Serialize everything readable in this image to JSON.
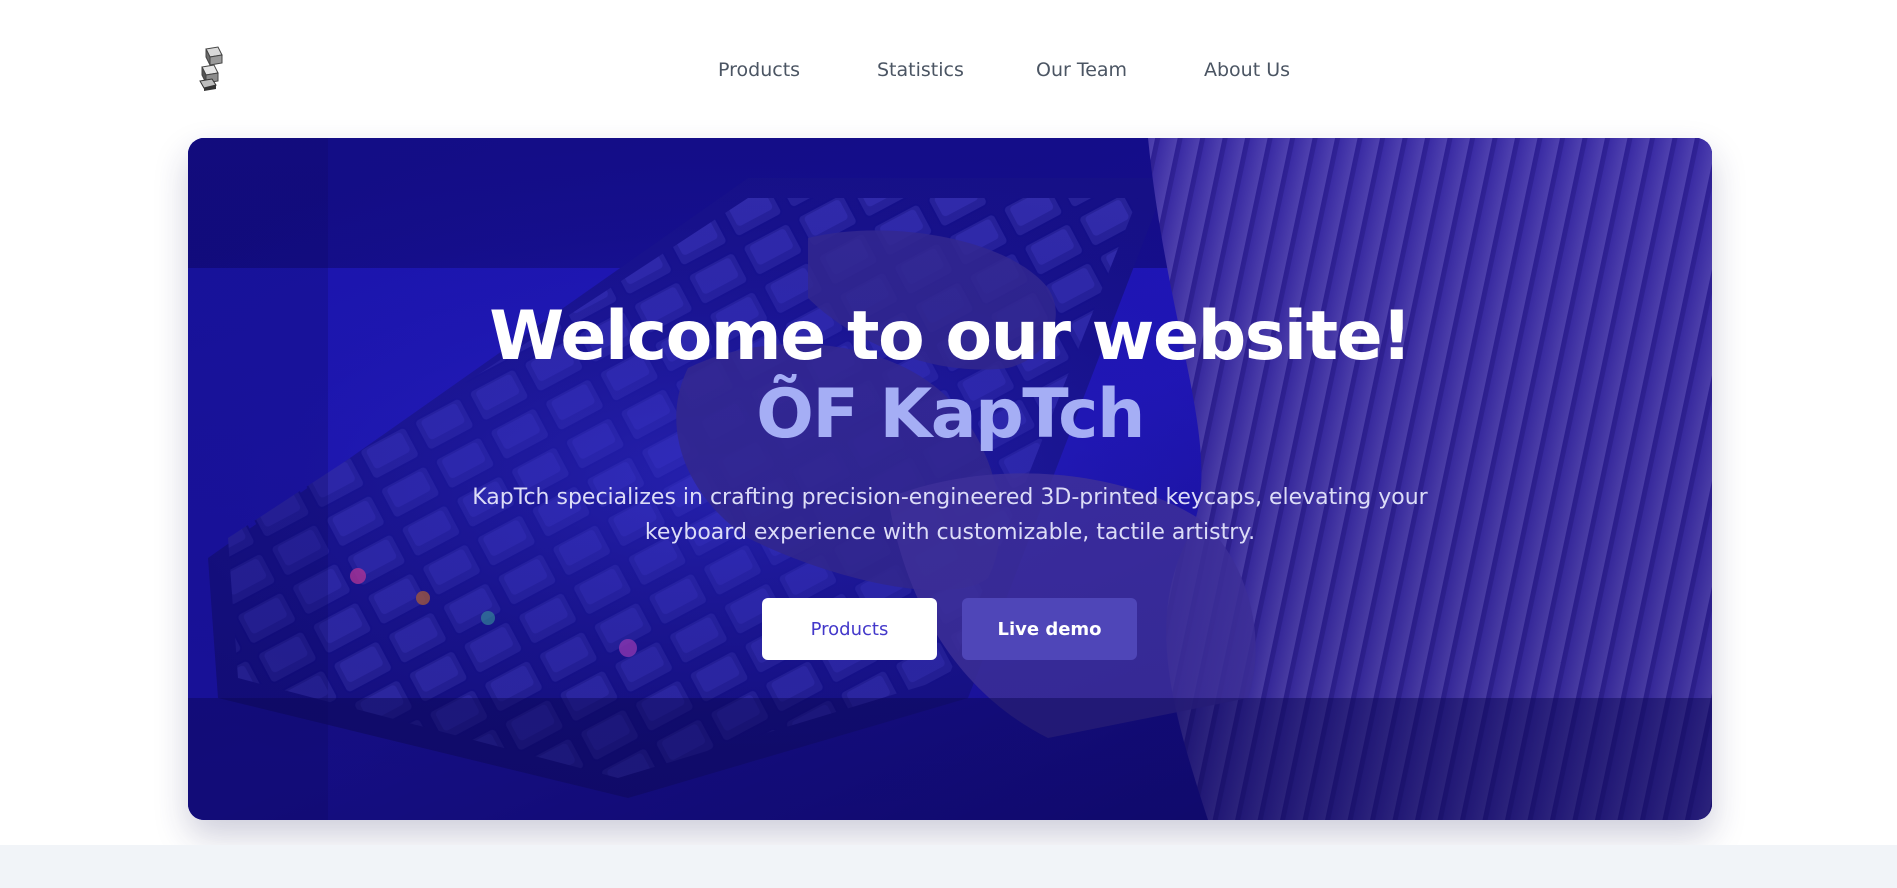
{
  "header": {
    "logo_icon": "keycap-stack-icon",
    "nav": [
      {
        "label": "Products"
      },
      {
        "label": "Statistics"
      },
      {
        "label": "Our Team"
      },
      {
        "label": "About Us"
      }
    ]
  },
  "hero": {
    "title": "Welcome to our website!",
    "brand": "ÕF KapTch",
    "description": "KapTch specializes in crafting precision-engineered 3D-printed keycaps, elevating your keyboard experience with customizable, tactile artistry.",
    "buttons": {
      "products_label": "Products",
      "demo_label": "Live demo"
    },
    "colors": {
      "title": "#ffffff",
      "brand": "#a5aef5",
      "button_primary_text": "#4338ca",
      "button_demo_bg": "#4f46b8"
    }
  }
}
